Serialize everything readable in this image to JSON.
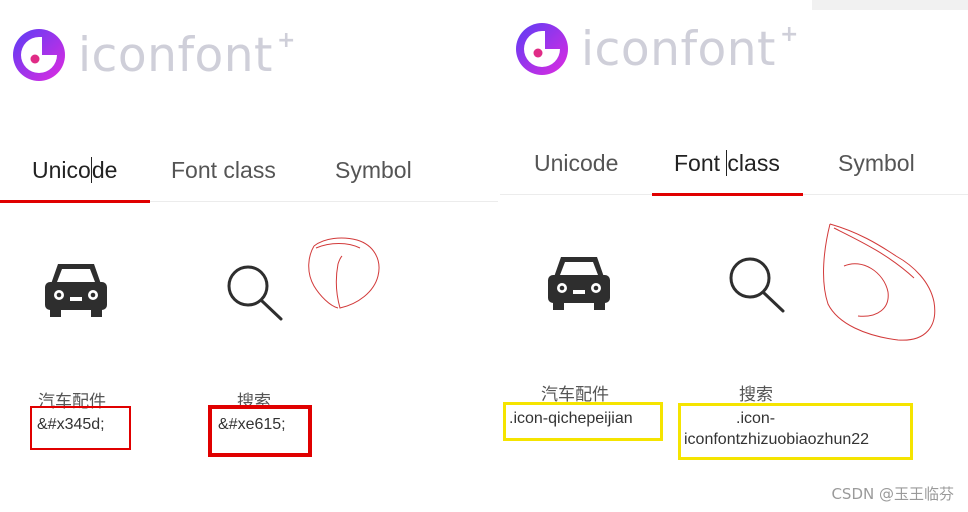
{
  "logo": {
    "text": "iconfont",
    "plus": "+"
  },
  "tabs": {
    "left": [
      {
        "label_a": "Unico",
        "label_b": "de",
        "active": true
      },
      {
        "label": "Font class"
      },
      {
        "label": "Symbol"
      }
    ],
    "right": [
      {
        "label": "Unicode"
      },
      {
        "label_a": "Font ",
        "label_b": "class",
        "active": true
      },
      {
        "label": "Symbol"
      }
    ]
  },
  "icons": {
    "left": [
      {
        "icon": "car-icon",
        "name": "汽车配件",
        "code": "&#x345d;"
      },
      {
        "icon": "search-icon",
        "name": "搜索",
        "code": "&#xe615;"
      }
    ],
    "right": [
      {
        "icon": "car-icon",
        "name": "汽车配件",
        "code": ".icon-qichepeijian"
      },
      {
        "icon": "search-icon",
        "name": "搜索",
        "code_line1": ".icon-",
        "code_line2": "iconfontzhizuobiaozhun22"
      }
    ]
  },
  "colors": {
    "annotation_red": "#e00000",
    "annotation_yellow": "#f5e400",
    "tab_underline": "#e00000"
  },
  "watermark": "CSDN @玉王临芬"
}
